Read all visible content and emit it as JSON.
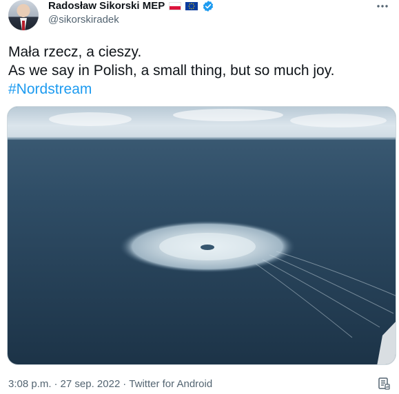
{
  "author": {
    "display_name": "Radosław Sikorski MEP",
    "handle": "@sikorskiradek",
    "badges": [
      "poland-flag-icon",
      "eu-flag-icon",
      "verified-badge-icon"
    ]
  },
  "tweet": {
    "lines": [
      "Mała rzecz, a cieszy.",
      "As we say in Polish, a small thing, but so much joy."
    ],
    "hashtag": "#Nordstream",
    "media": {
      "icon": "photo-sea-gas-leak"
    }
  },
  "meta": {
    "time": "3:08 p.m.",
    "separator": "·",
    "date": "27 sep. 2022",
    "source": "Twitter for Android"
  },
  "colors": {
    "accent": "#1d9bf0",
    "secondary_text": "#536471",
    "primary_text": "#0f1419"
  }
}
